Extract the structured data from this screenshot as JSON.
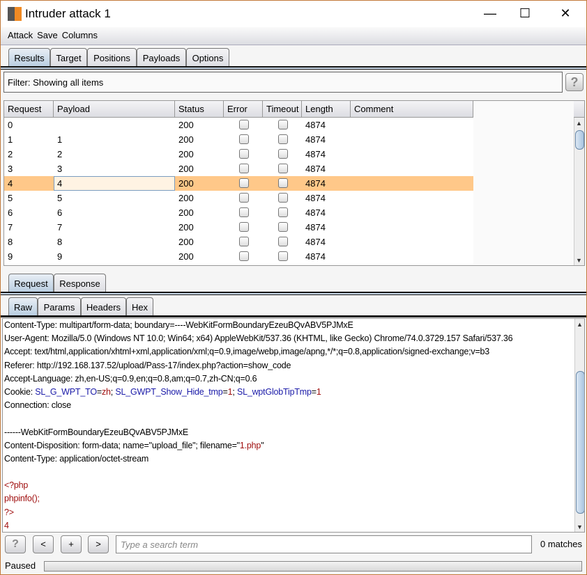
{
  "window": {
    "title": "Intruder attack 1",
    "minimize": "—",
    "maximize": "☐",
    "close": "✕"
  },
  "menu": [
    "Attack",
    "Save",
    "Columns"
  ],
  "main_tabs": [
    "Results",
    "Target",
    "Positions",
    "Payloads",
    "Options"
  ],
  "filter": {
    "text": "Filter: Showing all items",
    "help": "?"
  },
  "table": {
    "columns": [
      "Request",
      "Payload",
      "Status",
      "Error",
      "Timeout",
      "Length",
      "Comment"
    ],
    "sort_indicator": "▲",
    "selected_row": 4,
    "rows": [
      {
        "request": "0",
        "payload": "",
        "status": "200",
        "error": false,
        "timeout": false,
        "length": "4874",
        "comment": ""
      },
      {
        "request": "1",
        "payload": "1",
        "status": "200",
        "error": false,
        "timeout": false,
        "length": "4874",
        "comment": ""
      },
      {
        "request": "2",
        "payload": "2",
        "status": "200",
        "error": false,
        "timeout": false,
        "length": "4874",
        "comment": ""
      },
      {
        "request": "3",
        "payload": "3",
        "status": "200",
        "error": false,
        "timeout": false,
        "length": "4874",
        "comment": ""
      },
      {
        "request": "4",
        "payload": "4",
        "status": "200",
        "error": false,
        "timeout": false,
        "length": "4874",
        "comment": ""
      },
      {
        "request": "5",
        "payload": "5",
        "status": "200",
        "error": false,
        "timeout": false,
        "length": "4874",
        "comment": ""
      },
      {
        "request": "6",
        "payload": "6",
        "status": "200",
        "error": false,
        "timeout": false,
        "length": "4874",
        "comment": ""
      },
      {
        "request": "7",
        "payload": "7",
        "status": "200",
        "error": false,
        "timeout": false,
        "length": "4874",
        "comment": ""
      },
      {
        "request": "8",
        "payload": "8",
        "status": "200",
        "error": false,
        "timeout": false,
        "length": "4874",
        "comment": ""
      },
      {
        "request": "9",
        "payload": "9",
        "status": "200",
        "error": false,
        "timeout": false,
        "length": "4874",
        "comment": ""
      }
    ]
  },
  "msg_tabs": [
    "Request",
    "Response"
  ],
  "view_tabs": [
    "Raw",
    "Params",
    "Headers",
    "Hex"
  ],
  "editor": {
    "lines": [
      [
        {
          "t": "Content-Type: multipart/form-data; boundary=----WebKitFormBoundaryEzeuBQvABV5PJMxE",
          "c": ""
        }
      ],
      [
        {
          "t": "User-Agent: Mozilla/5.0 (Windows NT 10.0; Win64; x64) AppleWebKit/537.36 (KHTML, like Gecko) Chrome/74.0.3729.157 Safari/537.36",
          "c": ""
        }
      ],
      [
        {
          "t": "Accept: text/html,application/xhtml+xml,application/xml;q=0.9,image/webp,image/apng,*/*;q=0.8,application/signed-exchange;v=b3",
          "c": ""
        }
      ],
      [
        {
          "t": "Referer: http://192.168.137.52/upload/Pass-17/index.php?action=show_code",
          "c": ""
        }
      ],
      [
        {
          "t": "Accept-Language: zh,en-US;q=0.9,en;q=0.8,am;q=0.7,zh-CN;q=0.6",
          "c": ""
        }
      ],
      [
        {
          "t": "Cookie: ",
          "c": ""
        },
        {
          "t": "SL_G_WPT_TO",
          "c": "blue"
        },
        {
          "t": "=",
          "c": ""
        },
        {
          "t": "zh",
          "c": "red"
        },
        {
          "t": "; ",
          "c": ""
        },
        {
          "t": "SL_GWPT_Show_Hide_tmp",
          "c": "blue"
        },
        {
          "t": "=",
          "c": ""
        },
        {
          "t": "1",
          "c": "red"
        },
        {
          "t": "; ",
          "c": ""
        },
        {
          "t": "SL_wptGlobTipTmp",
          "c": "blue"
        },
        {
          "t": "=",
          "c": ""
        },
        {
          "t": "1",
          "c": "red"
        }
      ],
      [
        {
          "t": "Connection: close",
          "c": ""
        }
      ],
      [
        {
          "t": "",
          "c": ""
        }
      ],
      [
        {
          "t": "------WebKitFormBoundaryEzeuBQvABV5PJMxE",
          "c": ""
        }
      ],
      [
        {
          "t": "Content-Disposition: form-data; name=\"upload_file\"; filename=\"",
          "c": ""
        },
        {
          "t": "1.php",
          "c": "red"
        },
        {
          "t": "\"",
          "c": ""
        }
      ],
      [
        {
          "t": "Content-Type: application/octet-stream",
          "c": ""
        }
      ],
      [
        {
          "t": "",
          "c": ""
        }
      ],
      [
        {
          "t": "<?php",
          "c": "red"
        }
      ],
      [
        {
          "t": "phpinfo();",
          "c": "red"
        }
      ],
      [
        {
          "t": "?>",
          "c": "red"
        }
      ],
      [
        {
          "t": "4",
          "c": "red"
        }
      ]
    ]
  },
  "search": {
    "help": "?",
    "prev": "<",
    "add": "+",
    "next": ">",
    "placeholder": "Type a search term",
    "matches": "0 matches"
  },
  "status": {
    "text": "Paused"
  },
  "colors": {
    "selected_row": "#ffc889",
    "window_border": "#c27a3a",
    "highlight_blue": "#1a1aa8",
    "highlight_red": "#a01010"
  }
}
